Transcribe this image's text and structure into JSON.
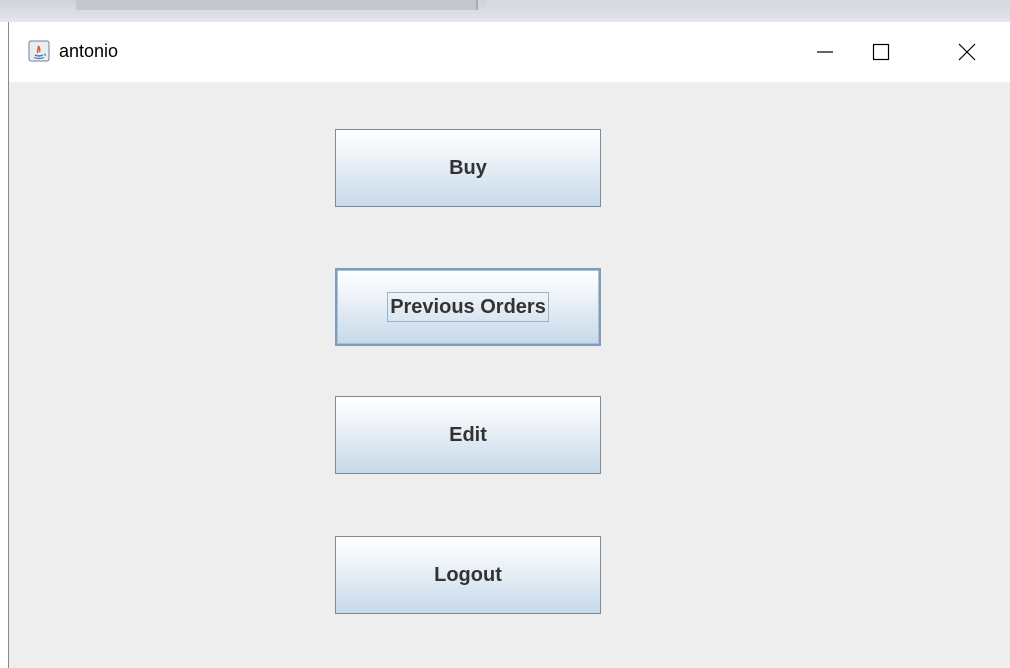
{
  "window": {
    "title": "antonio",
    "icon": "java-app-icon",
    "controls": [
      "minimize-icon",
      "maximize-icon",
      "close-icon"
    ]
  },
  "menu": {
    "buy_label": "Buy",
    "previous_orders_label": "Previous Orders",
    "edit_label": "Edit",
    "logout_label": "Logout",
    "focused": "Previous Orders"
  },
  "colors": {
    "content_bg": "#eeeeee",
    "button_border": "#7a8a99",
    "button_text": "#333333",
    "focus_ring": "#99b4d1"
  }
}
